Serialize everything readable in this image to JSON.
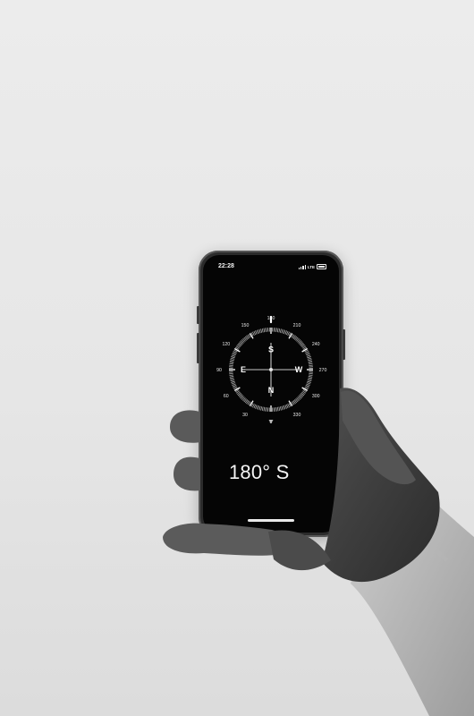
{
  "status_bar": {
    "time": "22:28",
    "network": "LTE"
  },
  "compass": {
    "cardinals": [
      "S",
      "W",
      "N",
      "E"
    ],
    "degree_labels": [
      "180",
      "210",
      "240",
      "270",
      "300",
      "330",
      "0",
      "30",
      "60",
      "90",
      "120",
      "150"
    ],
    "heading_degrees": 180
  },
  "heading": "180° S",
  "colors": {
    "background": "#e8e8e8",
    "screen": "#050505",
    "text": "#f4f4f4"
  }
}
